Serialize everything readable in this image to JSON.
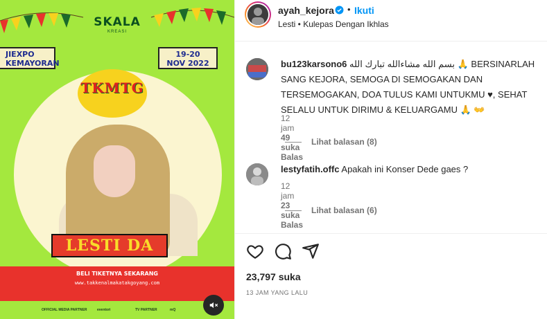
{
  "media": {
    "brand": "SKALA",
    "brand_sub": "KREASI",
    "venue_line1": "JIEXPO",
    "venue_line2": "KEMAYORAN",
    "date_line1": "19-20",
    "date_line2": "NOV 2022",
    "sun_text": "TKMTG",
    "name_banner": "LESTI DA",
    "ticket_title": "BELI TIKETNYA SEKARANG",
    "ticket_url": "www.takkenalmakatakgoyang.com",
    "sponsors": [
      "OFFICIAL MEDIA PARTNER",
      "eventori",
      "TV PARTNER",
      "mQ"
    ],
    "mute_icon": "speaker-muted-icon"
  },
  "post": {
    "username": "ayah_kejora",
    "follow_label": "Ikuti",
    "separator": "•",
    "location": "Lesti • Kulepas Dengan Ikhlas",
    "verified_color": "#0095f6"
  },
  "comments": [
    {
      "username": "bu123karsono6",
      "text": " بسم الله مشاءالله تبارك الله 🙏 BERSINARLAH SANG KEJORA, SEMOGA DI SEMOGAKAN DAN TERSEMOGAKAN, DOA TULUS KAMI UNTUKMU ♥, SEHAT SELALU UNTUK DIRIMU & KELUARGAMU 🙏 👐",
      "time": "12 jam",
      "likes": "49 suka",
      "reply_label": "Balas",
      "view_replies": "Lihat balasan (8)"
    },
    {
      "username": "lestyfatih.offc",
      "text": " Apakah ini Konser Dede gaes ?",
      "time": "12 jam",
      "likes": "23 suka",
      "reply_label": "Balas",
      "view_replies": "Lihat balasan (6)"
    }
  ],
  "actions": {
    "like_icon": "heart-icon",
    "comment_icon": "comment-icon",
    "share_icon": "share-icon",
    "likes_count": "23,797 suka",
    "timestamp": "13 JAM YANG LALU"
  }
}
